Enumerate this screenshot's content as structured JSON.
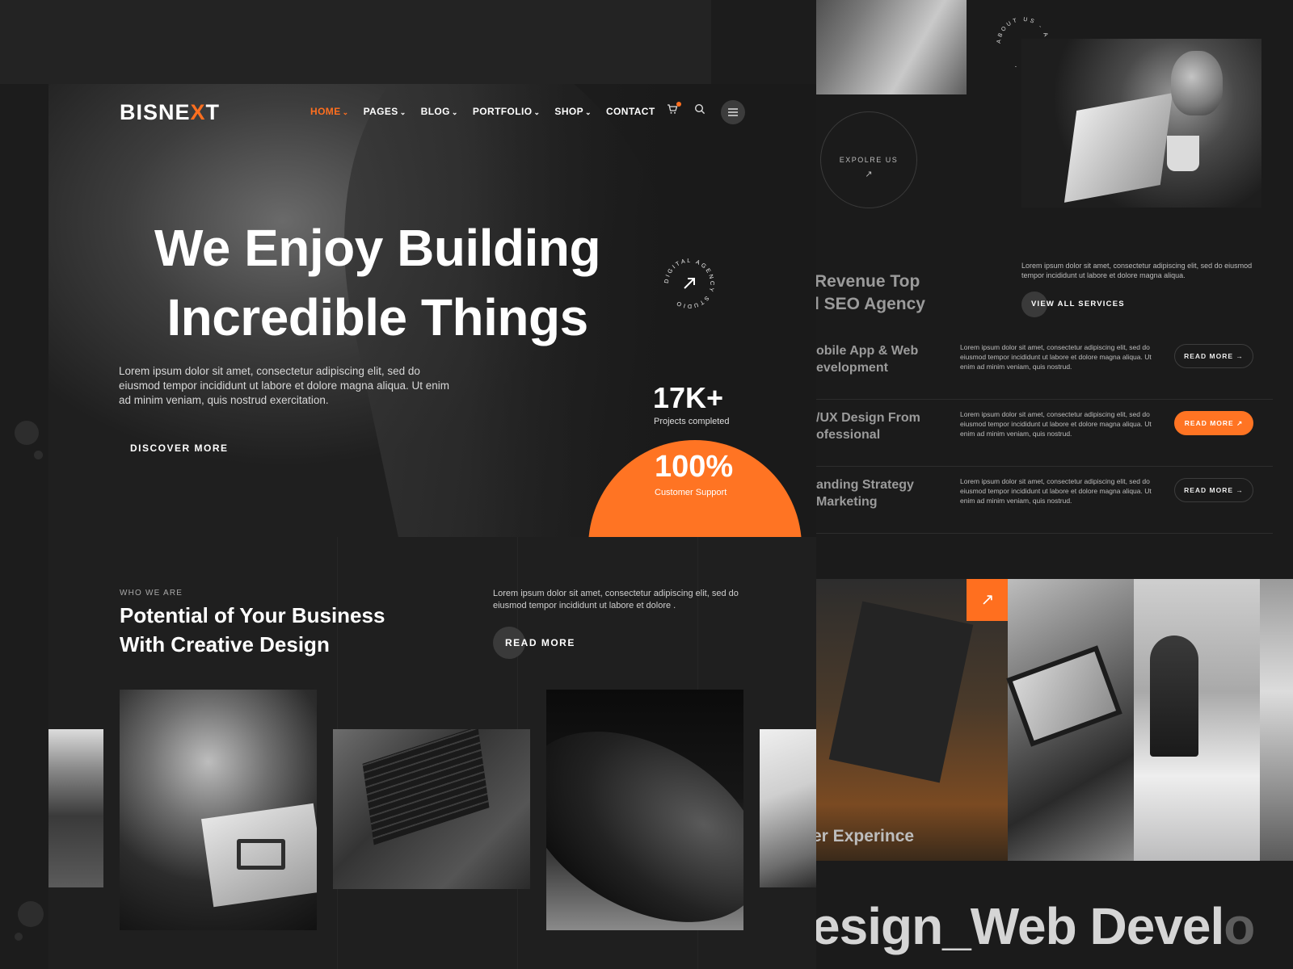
{
  "brand": {
    "logo_prefix": "BISNE",
    "logo_x": "X",
    "logo_suffix": "T",
    "accent": "#ff6f1f"
  },
  "nav": {
    "items": [
      {
        "label": "HOME",
        "active": true,
        "dropdown": true
      },
      {
        "label": "PAGES",
        "dropdown": true
      },
      {
        "label": "BLOG",
        "dropdown": true
      },
      {
        "label": "PORTFOLIO",
        "dropdown": true
      },
      {
        "label": "SHOP",
        "dropdown": true
      },
      {
        "label": "CONTACT",
        "dropdown": false
      }
    ],
    "icons": [
      "cart-icon",
      "search-icon",
      "hamburger-menu-icon"
    ]
  },
  "hero": {
    "title_line1": "We Enjoy Building",
    "title_line2": "Incredible Things",
    "description": "Lorem ipsum dolor sit amet, consectetur adipiscing elit, sed do eiusmod tempor incididunt ut labore et dolore magna aliqua. Ut enim ad minim veniam, quis nostrud exercitation.",
    "cta": "DISCOVER MORE",
    "badge_text": "DIGITAL AGENCY STUDIO",
    "stat1_value": "17K+",
    "stat1_label": "Projects completed",
    "stat2_value": "100%",
    "stat2_label": "Customer Support"
  },
  "who": {
    "label": "WHO WE ARE",
    "title_line1": "Potential of Your Business",
    "title_line2": "With Creative Design",
    "description": "Lorem ipsum dolor sit amet, consectetur adipiscing elit, sed do eiusmod tempor incididunt ut labore et dolore .",
    "cta": "READ MORE"
  },
  "right": {
    "about_badge": "ABOUT US - ABOUT US -",
    "explore": "EXPOLRE US",
    "services_title_line1": "Revenue Top",
    "services_title_line2": "l SEO Agency",
    "services_desc": "Lorem ipsum dolor sit amet, consectetur adipiscing elit, sed do eiusmod tempor incididunt ut labore et dolore magna aliqua.",
    "view_all": "VIEW ALL SERVICES",
    "services": [
      {
        "name": "obile App & Web\nevelopment",
        "desc": "Lorem ipsum dolor sit amet, consectetur adipiscing elit, sed do eiusmod tempor incididunt ut labore et dolore magna aliqua. Ut enim ad minim veniam, quis nostrud.",
        "cta": "READ MORE →",
        "highlight": false
      },
      {
        "name": "/UX Design From\nofessional",
        "desc": "Lorem ipsum dolor sit amet, consectetur adipiscing elit, sed do eiusmod tempor incididunt ut labore et dolore magna aliqua. Ut enim ad minim veniam, quis nostrud.",
        "cta": "READ MORE ↗",
        "highlight": true
      },
      {
        "name": "anding Strategy\nMarketing",
        "desc": "Lorem ipsum dolor sit amet, consectetur adipiscing elit, sed do eiusmod tempor incididunt ut labore et dolore magna aliqua. Ut enim ad minim veniam, quis nostrud.",
        "cta": "READ MORE →",
        "highlight": false
      }
    ],
    "photo_caption": "er Experince",
    "arrow": "↗",
    "marquee_bright": "esign_Web Devel",
    "marquee_dim": "o"
  }
}
